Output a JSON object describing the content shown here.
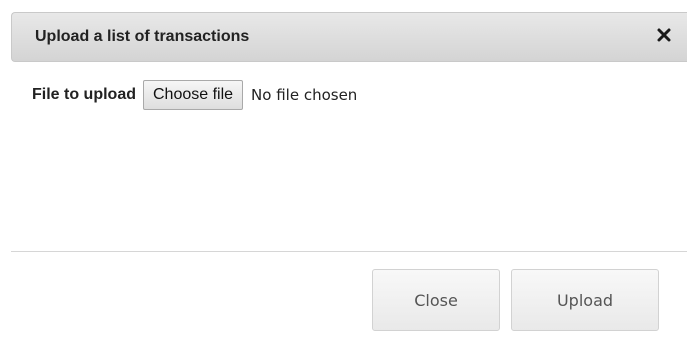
{
  "dialog": {
    "title": "Upload a list of transactions",
    "close_icon": "close-x-icon"
  },
  "form": {
    "file_label": "File to upload",
    "choose_button": "Choose file",
    "file_status": "No file chosen"
  },
  "footer": {
    "close_label": "Close",
    "upload_label": "Upload"
  }
}
